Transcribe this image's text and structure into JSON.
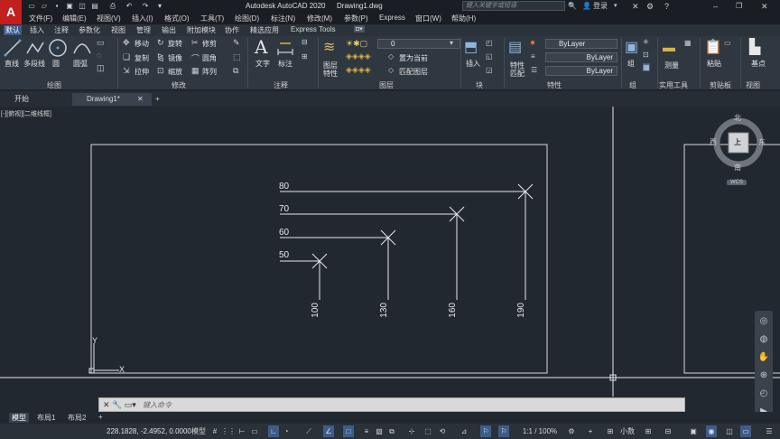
{
  "app": {
    "logo_letter": "A",
    "title": "Autodesk AutoCAD 2020",
    "filename": "Drawing1.dwg",
    "search_placeholder": "键入关键字或短语",
    "login_label": "登录",
    "window_controls": [
      "–",
      "❐",
      "✕"
    ],
    "quick_access_icons": [
      "new-file-icon",
      "open-icon",
      "save-icon",
      "save-as-icon",
      "print-icon",
      "undo-icon",
      "redo-icon",
      "dropdown-icon"
    ]
  },
  "menu": {
    "items": [
      "文件(F)",
      "编辑(E)",
      "视图(V)",
      "插入(I)",
      "格式(O)",
      "工具(T)",
      "绘图(D)",
      "标注(N)",
      "修改(M)",
      "参数(P)",
      "Express",
      "窗口(W)",
      "帮助(H)"
    ]
  },
  "ribbon_tabs": {
    "items": [
      "默认",
      "插入",
      "注释",
      "参数化",
      "视图",
      "管理",
      "输出",
      "附加模块",
      "协作",
      "精选应用",
      "Express Tools"
    ],
    "active_index": 0
  },
  "ribbon": {
    "draw": {
      "line": "直线",
      "polyline": "多段线",
      "circle": "圆",
      "arc": "圆弧",
      "title": "绘图"
    },
    "modify": {
      "move": "移动",
      "rotate": "旋转",
      "trim": "修剪",
      "copy": "复制",
      "mirror": "镜像",
      "fillet": "圆角",
      "stretch": "拉伸",
      "scale": "缩放",
      "array": "阵列",
      "title": "修改"
    },
    "annotation": {
      "text": "文字",
      "dimension": "标注",
      "title": "注释"
    },
    "layers": {
      "layer_props_line1": "图层",
      "layer_props_line2": "特性",
      "current_layer": "0",
      "make_current": "置为当前",
      "match_layer": "匹配图层",
      "title": "图层"
    },
    "block": {
      "insert": "插入",
      "title": "块"
    },
    "properties": {
      "match_line1": "特性",
      "match_line2": "匹配",
      "color": "ByLayer",
      "linetype": "ByLayer",
      "lineweight": "ByLayer",
      "title": "特性"
    },
    "groups": {
      "group": "组",
      "title": "组"
    },
    "utilities": {
      "measure": "测量",
      "title": "实用工具"
    },
    "clipboard": {
      "paste": "粘贴",
      "title": "剪贴板"
    },
    "view": {
      "base": "基点",
      "title": "视图"
    }
  },
  "file_tabs": {
    "start": "开始",
    "drawing": "Drawing1*",
    "close_glyph": "✕",
    "add_glyph": "+"
  },
  "viewport": {
    "label": "[-][俯视][二维线框]",
    "ucs_y": "Y",
    "ucs_x": "X"
  },
  "drawing": {
    "horizontal_labels": [
      "80",
      "70",
      "60",
      "50"
    ],
    "vertical_labels": [
      "100",
      "130",
      "160",
      "190"
    ]
  },
  "viewcube": {
    "north": "北",
    "south": "南",
    "east": "东",
    "west": "西",
    "top": "上",
    "wcs": "WCS"
  },
  "command_line": {
    "placeholder": "键入命令"
  },
  "layout_tabs": {
    "items": [
      "模型",
      "布局1",
      "布局2"
    ],
    "add_glyph": "+",
    "active_index": 0
  },
  "status_bar": {
    "coordinates": "228.1828, -2.4952, 0.0000",
    "model_label": "模型",
    "scale": "1:1 / 100%",
    "units": "小数"
  },
  "colors": {
    "background": "#212830",
    "accent": "#3b5b8a",
    "logo": "#c21f1f"
  }
}
